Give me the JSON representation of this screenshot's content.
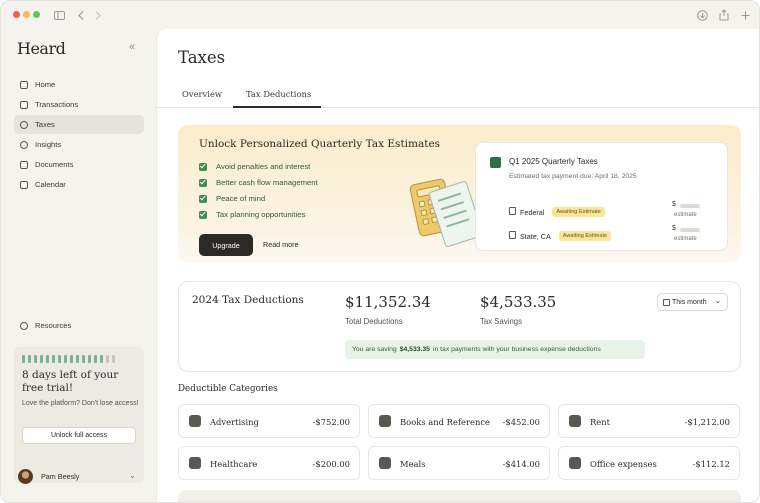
{
  "brand": "Heard",
  "sidebar": {
    "items": [
      {
        "label": "Home",
        "icon": "home-icon"
      },
      {
        "label": "Transactions",
        "icon": "receipt-icon"
      },
      {
        "label": "Taxes",
        "icon": "tax-icon"
      },
      {
        "label": "Insights",
        "icon": "insights-icon"
      },
      {
        "label": "Documents",
        "icon": "document-icon"
      },
      {
        "label": "Calendar",
        "icon": "calendar-icon"
      }
    ],
    "resources": "Resources",
    "trial": {
      "title": "8 days left of your free trial!",
      "text": "Love the platform? Don't lose access!",
      "button": "Unlock full access"
    },
    "user": {
      "name": "Pam Beesly"
    }
  },
  "main": {
    "title": "Taxes",
    "tabs": [
      {
        "label": "Overview"
      },
      {
        "label": "Tax Deductions"
      }
    ],
    "promo": {
      "title": "Unlock Personalized Quarterly Tax Estimates",
      "benefits": [
        "Avoid penalties and interest",
        "Better cash flow management",
        "Peace of mind",
        "Tax planning opportunities"
      ],
      "upgrade": "Upgrade",
      "read_more": "Read more",
      "card": {
        "title": "Q1 2025 Quarterly Taxes",
        "subtitle": "Estimated tax payment due: April 18, 2025",
        "rows": [
          {
            "label": "Federal",
            "badge": "Awaiting Estimate",
            "dollar": "$",
            "note": "estimate"
          },
          {
            "label": "State, CA",
            "badge": "Awaiting Estimate",
            "dollar": "$",
            "note": "estimate"
          }
        ]
      }
    },
    "deductions": {
      "title": "2024 Tax Deductions",
      "total_value": "$11,352.34",
      "total_label": "Total Deductions",
      "savings_value": "$4,533.35",
      "savings_label": "Tax Savings",
      "period": "This month",
      "saving_prefix": "You are saving",
      "saving_amount": "$4,533.35",
      "saving_suffix": "in tax payments with your business expense deductions"
    },
    "categories_heading": "Deductible Categories",
    "categories": [
      {
        "name": "Advertising",
        "value": "-$752.00",
        "icon": "megaphone-icon"
      },
      {
        "name": "Books and Reference",
        "value": "-$452.00",
        "icon": "book-icon"
      },
      {
        "name": "Rent",
        "value": "-$1,212.00",
        "icon": "building-icon"
      },
      {
        "name": "Healthcare",
        "value": "-$200.00",
        "icon": "heart-icon"
      },
      {
        "name": "Meals",
        "value": "-$414.00",
        "icon": "meal-icon"
      },
      {
        "name": "Office expenses",
        "value": "-$112.12",
        "icon": "office-icon"
      }
    ]
  },
  "colors": {
    "accent_green": "#3d8e57",
    "badge_yellow": "#f8e59a",
    "promo_bg": "#fbeccb",
    "sidebar_bg": "#f5f3ee"
  }
}
